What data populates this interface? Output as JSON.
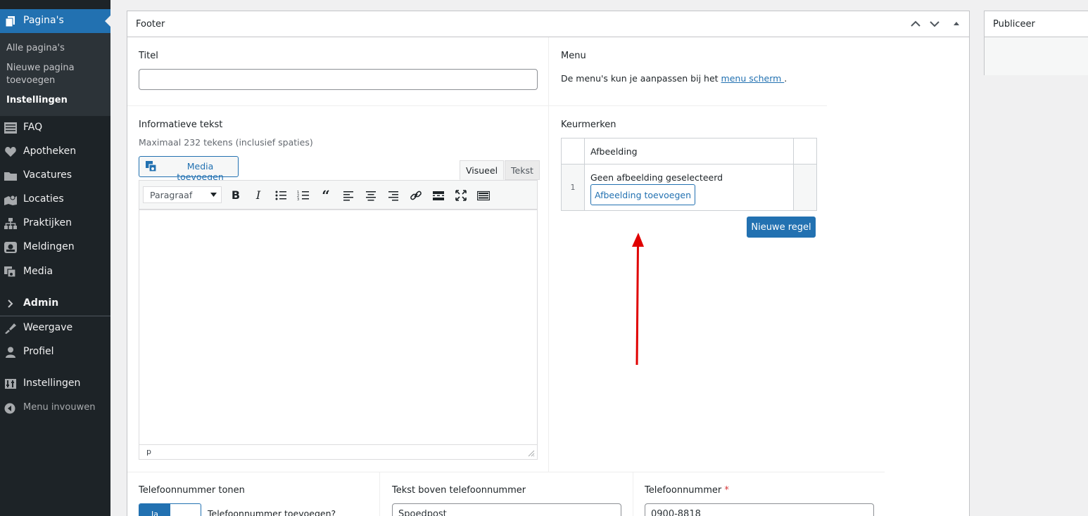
{
  "sidebar": {
    "current": "Pagina's",
    "submenu": [
      "Alle pagina's",
      "Nieuwe pagina",
      "toevoegen",
      "Instellingen"
    ],
    "items": [
      "FAQ",
      "Apotheken",
      "Vacatures",
      "Locaties",
      "Praktijken",
      "Meldingen",
      "Media",
      "Admin",
      "Weergave",
      "Profiel",
      "Instellingen",
      "Menu invouwen"
    ]
  },
  "box": {
    "title": "Footer",
    "titel_label": "Titel",
    "titel_value": "",
    "menu_label": "Menu",
    "menu_text": "De menu's kun je aanpassen bij het ",
    "menu_link": "menu scherm ",
    "menu_end": ".",
    "info_label": "Informatieve tekst",
    "info_desc": "Maximaal 232 tekens (inclusief spaties)",
    "media_button": "Media toevoegen",
    "tab_visual": "Visueel",
    "tab_text": "Tekst",
    "format_select": "Paragraaf",
    "status_path": "p",
    "keur_label": "Keurmerken",
    "keur_col": "Afbeelding",
    "keur_row_num": "1",
    "keur_none": "Geen afbeelding geselecteerd",
    "keur_add": "Afbeelding toevoegen",
    "new_row": "Nieuwe regel",
    "phone_show_label": "Telefoonnummer tonen",
    "toggle_on": "Ja",
    "phone_question": "Telefoonnummer toevoegen?",
    "phone_above_label": "Tekst boven telefoonnummer",
    "phone_above_value": "Spoedpost",
    "phone_label": "Telefoonnummer",
    "required_mark": "*",
    "phone_value": "0900-8818"
  },
  "publish": {
    "title": "Publiceer"
  },
  "colors": {
    "accent": "#2271b1",
    "sidebar": "#1d2327",
    "arrow": "#e00000",
    "required": "#d63638"
  }
}
